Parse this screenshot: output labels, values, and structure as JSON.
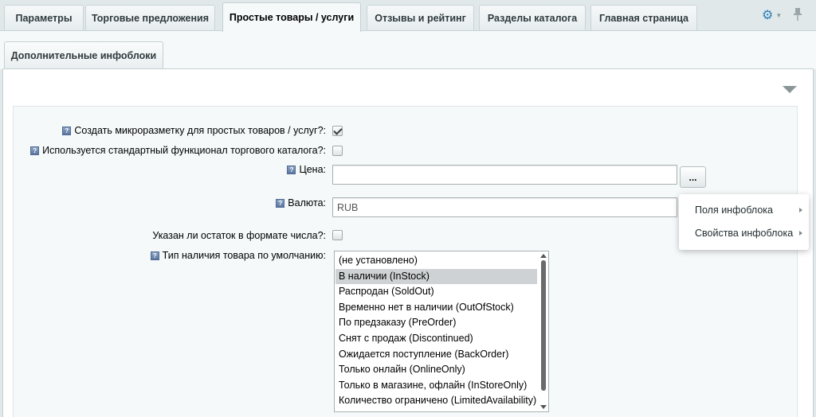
{
  "tabs": [
    {
      "label": "Параметры"
    },
    {
      "label": "Торговые предложения"
    },
    {
      "label": "Простые товары / услуги"
    },
    {
      "label": "Отзывы и рейтинг"
    },
    {
      "label": "Разделы каталога"
    },
    {
      "label": "Главная страница"
    }
  ],
  "active_tab": "Простые товары / услуги",
  "icons": {
    "settings": "gear-icon",
    "pin": "pin-icon",
    "help": "help-icon"
  },
  "subtab": {
    "label": "Дополнительные инфоблоки"
  },
  "form": {
    "create_markup": {
      "label": "Создать микроразметку для простых товаров / услуг?:",
      "checked": true
    },
    "standard_catalog": {
      "label": "Используется стандартный функционал торгового каталога?:",
      "checked": false
    },
    "price": {
      "label": "Цена:",
      "value": ""
    },
    "price_button": "...",
    "currency": {
      "label": "Валюта:",
      "value": "RUB"
    },
    "stock_numeric": {
      "label": "Указан ли остаток в формате числа?:",
      "checked": false
    },
    "availability": {
      "label": "Тип наличия товара по умолчанию:",
      "options": [
        "(не установлено)",
        "В наличии (InStock)",
        "Распродан (SoldOut)",
        "Временно нет в наличии (OutOfStock)",
        "По предзаказу (PreOrder)",
        "Снят с продаж (Discontinued)",
        "Ожидается поступление (BackOrder)",
        "Только онлайн (OnlineOnly)",
        "Только в магазине, офлайн (InStoreOnly)",
        "Количество ограничено (LimitedAvailability)"
      ],
      "selected": "В наличии (InStock)"
    }
  },
  "menu": {
    "items": [
      {
        "label": "Поля инфоблока"
      },
      {
        "label": "Свойства инфоблока"
      }
    ]
  },
  "colors": {
    "accent": "#2e7fb8",
    "background": "#e0e8ea",
    "panel": "#f5f9f9",
    "selected": "#cfd2d4"
  }
}
